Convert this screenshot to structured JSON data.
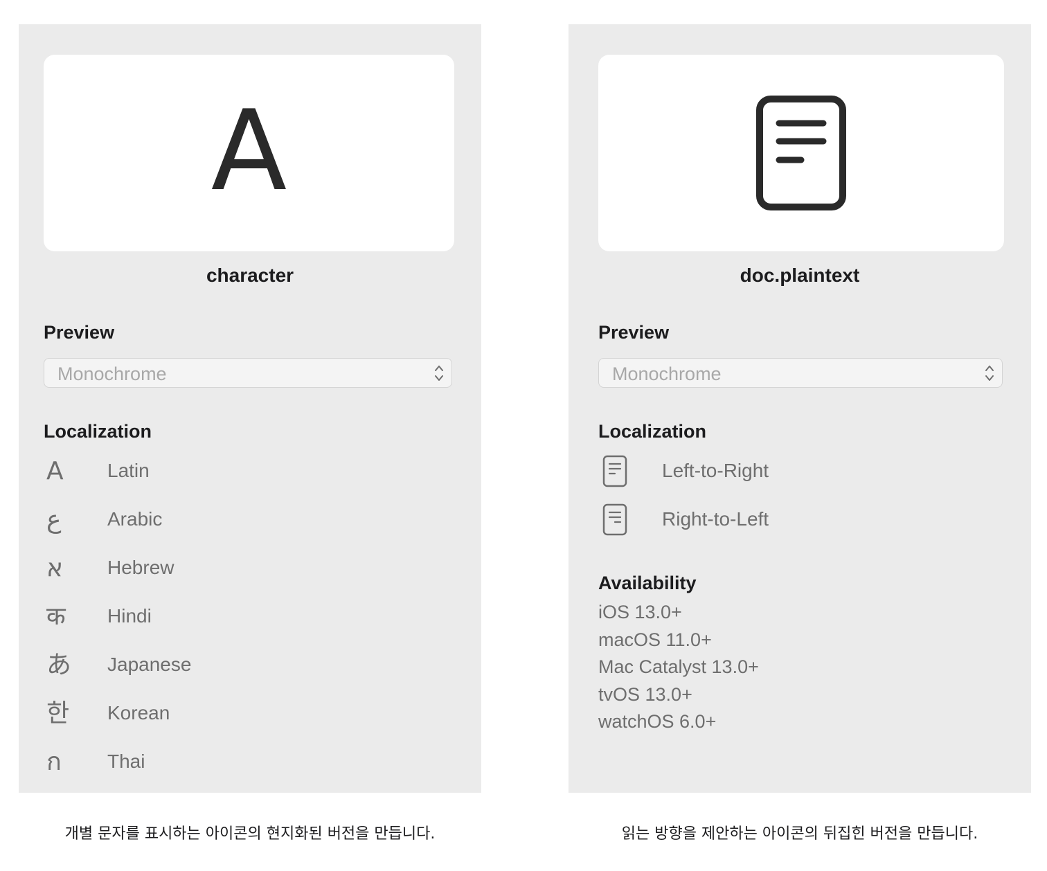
{
  "left_panel": {
    "symbol_glyph": "A",
    "symbol_name": "character",
    "preview_title": "Preview",
    "preview_select_value": "Monochrome",
    "localization_title": "Localization",
    "localizations": [
      {
        "glyph": "A",
        "label": "Latin",
        "icon": "latin-a-icon"
      },
      {
        "glyph": "ع",
        "label": "Arabic",
        "icon": "arabic-ayn-icon"
      },
      {
        "glyph": "א",
        "label": "Hebrew",
        "icon": "hebrew-alef-icon"
      },
      {
        "glyph": "क",
        "label": "Hindi",
        "icon": "devanagari-ka-icon"
      },
      {
        "glyph": "あ",
        "label": "Japanese",
        "icon": "hiragana-a-icon"
      },
      {
        "glyph": "한",
        "label": "Korean",
        "icon": "hangul-han-icon"
      },
      {
        "glyph": "ก",
        "label": "Thai",
        "icon": "thai-ko-kai-icon"
      }
    ]
  },
  "right_panel": {
    "symbol_name": "doc.plaintext",
    "preview_title": "Preview",
    "preview_select_value": "Monochrome",
    "localization_title": "Localization",
    "localizations": [
      {
        "label": "Left-to-Right",
        "icon": "doc-plaintext-ltr-icon"
      },
      {
        "label": "Right-to-Left",
        "icon": "doc-plaintext-rtl-icon"
      }
    ],
    "availability_title": "Availability",
    "availability": [
      "iOS 13.0+",
      "macOS 11.0+",
      "Mac Catalyst 13.0+",
      "tvOS 13.0+",
      "watchOS 6.0+"
    ]
  },
  "captions": {
    "left": "개별 문자를 표시하는 아이콘의 현지화된 버전을 만듭니다.",
    "right": "읽는 방향을 제안하는 아이콘의 뒤집힌 버전을 만듭니다."
  },
  "colors": {
    "panel_background": "#ebebeb",
    "card_background": "#ffffff",
    "secondary_text": "#6e6e6e",
    "primary_text": "#1c1c1e"
  }
}
